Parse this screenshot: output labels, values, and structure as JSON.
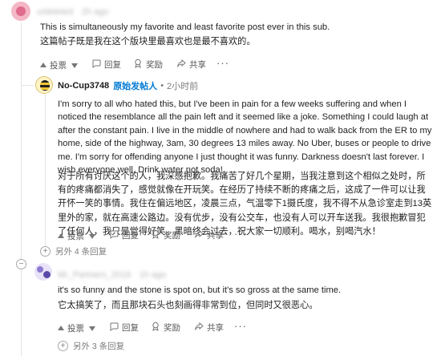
{
  "comment1": {
    "author_blurred": "u/deleted",
    "time_blurred": "2h ago",
    "text_en": "This is simultaneously my favorite and least favorite post ever in this sub.",
    "text_cn": "这篇帖子既是我在这个版块里最喜欢也是最不喜欢的。",
    "actions": {
      "upvote": "投票",
      "reply": "回复",
      "award": "奖励",
      "share": "共享",
      "more": "···"
    }
  },
  "comment2": {
    "author": "No-Cup3748",
    "op_badge": "原始发帖人",
    "separator": "•",
    "time": "2小时前",
    "text_en": "I'm sorry to all who hated this, but I've been in pain for a few weeks suffering and when I noticed the resemblance all the pain left and it seemed like a joke. Something I could laugh at after the constant pain. I live in the middle of nowhere and had to walk back from the ER to my home, side of the highway, 3am, 30 degrees 13 miles away. No Uber, buses or people to drive me. I'm sorry for offending anyone I just thought it was funny. Darkness doesn't last forever. I wish everyone well. Drink water not soda!",
    "text_cn": "对于所有讨厌这个的人，我深感抱歉。我痛苦了好几个星期，当我注意到这个相似之处时，所有的疼痛都消失了，感觉就像在开玩笑。在经历了持续不断的疼痛之后，这成了一件可以让我开怀一笑的事情。我住在偏远地区，凌晨三点，气温零下1摄氏度，我不得不从急诊室走到13英里外的家，就在高速公路边。没有优步，没有公交车，也没有人可以开车送我。我很抱歉冒犯了任何人，我只是觉得好笑。黑暗终会过去，祝大家一切顺利。喝水，别喝汽水！",
    "actions": {
      "upvote": "投票",
      "reply": "回复",
      "award": "奖励",
      "share": "共享",
      "more": "···"
    },
    "more_replies": "另外 4 条回复"
  },
  "comment3": {
    "author_blurred": "Mr_Partners_2018",
    "time_blurred": "1h ago",
    "text_en": "it's so funny and the stone is spot on, but it's so gross at the same time.",
    "text_cn": "它太搞笑了，而且那块石头也刻画得非常到位，但同时又很恶心。",
    "actions": {
      "upvote": "投票",
      "reply": "回复",
      "award": "奖励",
      "share": "共享",
      "more": "···"
    },
    "more_replies": "另外 3 条回复"
  },
  "colors": {
    "op_blue": "#0079d3",
    "thread_line": "#e2e4e6",
    "meta_gray": "#7c7c7c"
  }
}
